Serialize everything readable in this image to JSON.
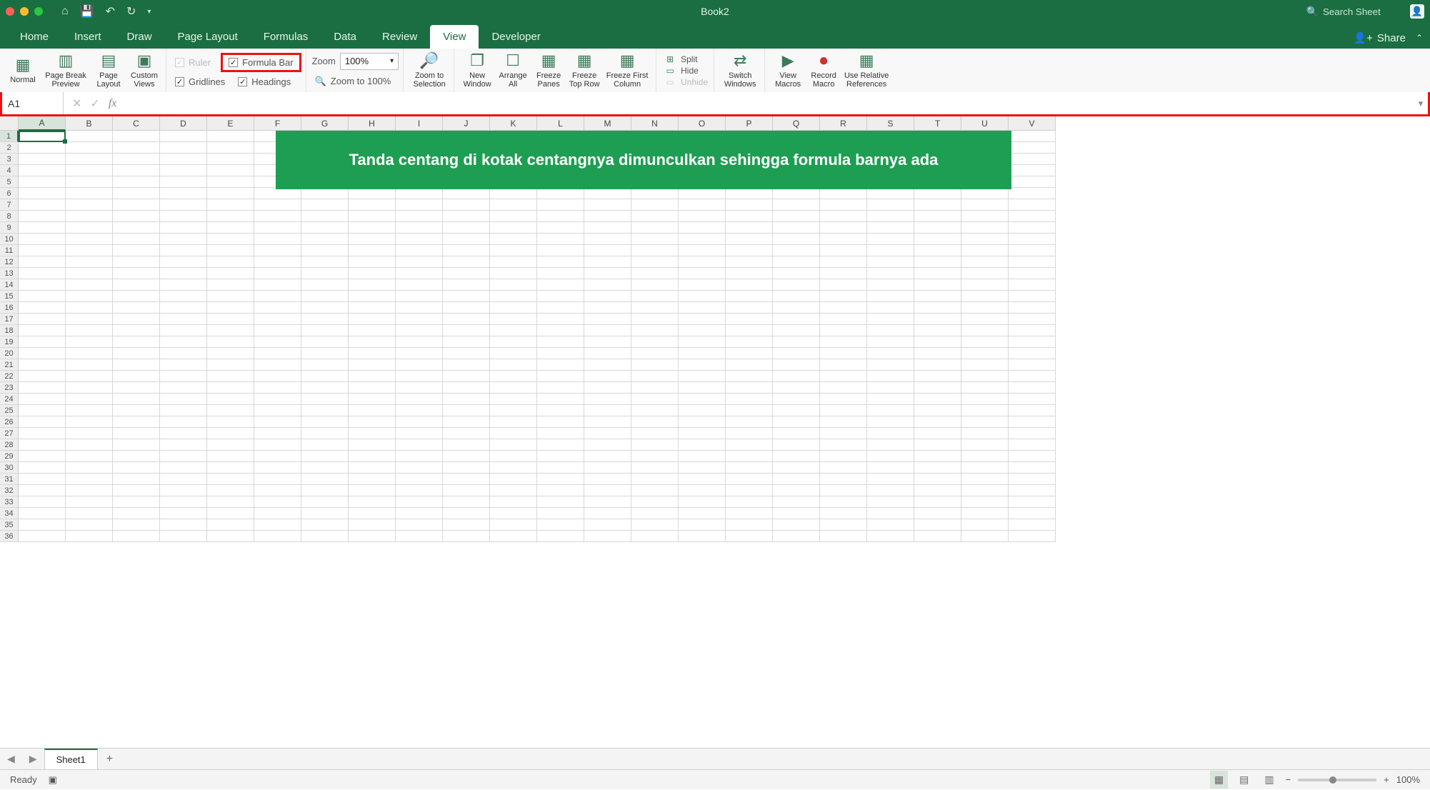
{
  "titlebar": {
    "title": "Book2",
    "search_placeholder": "Search Sheet"
  },
  "tabs": {
    "items": [
      "Home",
      "Insert",
      "Draw",
      "Page Layout",
      "Formulas",
      "Data",
      "Review",
      "View",
      "Developer"
    ],
    "active_index": 7,
    "share": "Share"
  },
  "ribbon": {
    "views": {
      "normal": "Normal",
      "pgbreak": "Page Break Preview",
      "pglayout": "Page Layout",
      "custom": "Custom Views"
    },
    "show": {
      "ruler": "Ruler",
      "formula_bar": "Formula Bar",
      "gridlines": "Gridlines",
      "headings": "Headings"
    },
    "zoom": {
      "label": "Zoom",
      "value": "100%",
      "to100": "Zoom to 100%",
      "to_sel": "Zoom to Selection"
    },
    "window": {
      "new_window": "New Window",
      "arrange_all": "Arrange All",
      "freeze_panes": "Freeze Panes",
      "freeze_top_row": "Freeze Top Row",
      "freeze_first_col": "Freeze First Column",
      "split": "Split",
      "hide": "Hide",
      "unhide": "Unhide",
      "switch": "Switch Windows"
    },
    "macros": {
      "view_macros": "View Macros",
      "record": "Record Macro",
      "relative": "Use Relative References"
    }
  },
  "formula_bar": {
    "name_box": "A1",
    "value": ""
  },
  "grid": {
    "columns": [
      "A",
      "B",
      "C",
      "D",
      "E",
      "F",
      "G",
      "H",
      "I",
      "J",
      "K",
      "L",
      "M",
      "N",
      "O",
      "P",
      "Q",
      "R",
      "S",
      "T",
      "U",
      "V"
    ],
    "rows": 36,
    "active_col": 0,
    "active_row": 0
  },
  "callout": {
    "text": "Tanda centang di kotak centangnya dimunculkan  sehingga formula barnya ada"
  },
  "sheets": {
    "active": "Sheet1"
  },
  "status": {
    "ready": "Ready",
    "zoom": "100%"
  }
}
